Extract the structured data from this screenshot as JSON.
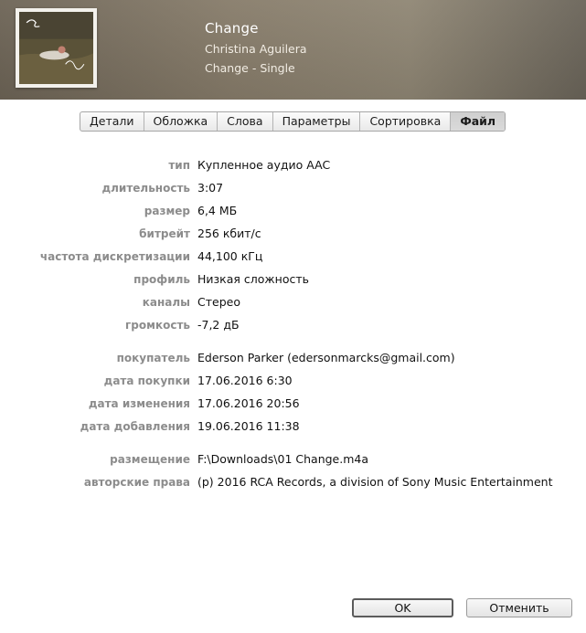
{
  "header": {
    "title": "Change",
    "artist": "Christina Aguilera",
    "album": "Change - Single"
  },
  "tabs": [
    {
      "label": "Детали"
    },
    {
      "label": "Обложка"
    },
    {
      "label": "Слова"
    },
    {
      "label": "Параметры"
    },
    {
      "label": "Сортировка"
    },
    {
      "label": "Файл",
      "active": true
    }
  ],
  "file_info": {
    "group1": [
      {
        "label": "тип",
        "value": "Купленное аудио AAC"
      },
      {
        "label": "длительность",
        "value": "3:07"
      },
      {
        "label": "размер",
        "value": "6,4 МБ"
      },
      {
        "label": "битрейт",
        "value": "256 кбит/с"
      },
      {
        "label": "частота дискретизации",
        "value": "44,100 кГц"
      },
      {
        "label": "профиль",
        "value": "Низкая сложность"
      },
      {
        "label": "каналы",
        "value": "Стерео"
      },
      {
        "label": "громкость",
        "value": "-7,2 дБ"
      }
    ],
    "group2": [
      {
        "label": "покупатель",
        "value": "Ederson Parker (edersonmarcks@gmail.com)"
      },
      {
        "label": "дата покупки",
        "value": "17.06.2016 6:30"
      },
      {
        "label": "дата изменения",
        "value": "17.06.2016 20:56"
      },
      {
        "label": "дата добавления",
        "value": "19.06.2016 11:38"
      }
    ],
    "group3": [
      {
        "label": "размещение",
        "value": "F:\\Downloads\\01 Change.m4a"
      },
      {
        "label": "авторские права",
        "value": "(p) 2016 RCA Records, a division of Sony Music Entertainment"
      }
    ]
  },
  "buttons": {
    "ok": "OK",
    "cancel": "Отменить"
  },
  "colors": {
    "header_bg": "#877c6a",
    "label_gray": "#8c8c8c",
    "active_tab": "#d4d4d4"
  }
}
